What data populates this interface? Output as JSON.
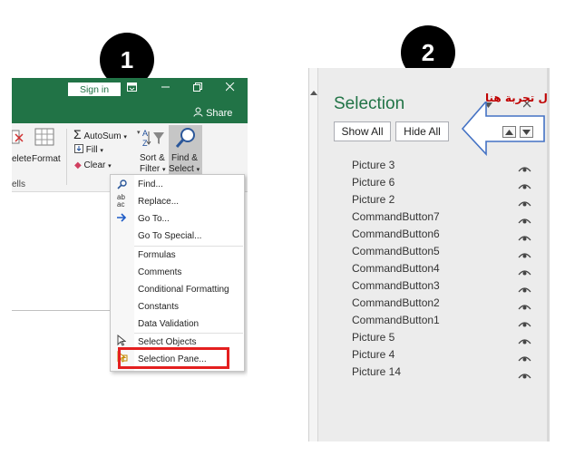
{
  "badges": {
    "step1": "1",
    "step2": "2"
  },
  "excel": {
    "signin": "Sign in",
    "share": "Share",
    "ribbon": {
      "delete_partial": "elete",
      "format": "Format",
      "cells_partial": "ells",
      "autosum": "AutoSum",
      "fill": "Fill",
      "clear": "Clear",
      "sort_filter_line1": "Sort &",
      "sort_filter_line2": "Filter",
      "find_select_line1": "Find &",
      "find_select_line2": "Select"
    },
    "menu": {
      "items": [
        {
          "label": "Find...",
          "icon": "magnifier-icon"
        },
        {
          "label": "Replace...",
          "icon": "replace-icon"
        },
        {
          "label": "Go To...",
          "icon": "arrow-right-icon"
        },
        {
          "label": "Go To Special...",
          "icon": ""
        },
        {
          "label": "Formulas",
          "icon": ""
        },
        {
          "label": "Comments",
          "icon": ""
        },
        {
          "label": "Conditional Formatting",
          "icon": ""
        },
        {
          "label": "Constants",
          "icon": ""
        },
        {
          "label": "Data Validation",
          "icon": ""
        },
        {
          "label": "Select Objects",
          "icon": "cursor-icon"
        },
        {
          "label": "Selection Pane...",
          "icon": "selection-pane-icon"
        }
      ]
    }
  },
  "selection_pane": {
    "title": "Selection",
    "annotation": "ل تجربة هنا",
    "show_all": "Show All",
    "hide_all": "Hide All",
    "items": [
      "Picture 3",
      "Picture 6",
      "Picture 2",
      "CommandButton7",
      "CommandButton6",
      "CommandButton5",
      "CommandButton4",
      "CommandButton3",
      "CommandButton2",
      "CommandButton1",
      "Picture 5",
      "Picture 4",
      "Picture 14"
    ]
  },
  "colors": {
    "excel_green": "#217346",
    "highlight_red": "#e41f1f",
    "arrow_blue": "#4472c4",
    "annotation_red": "#c00000"
  }
}
